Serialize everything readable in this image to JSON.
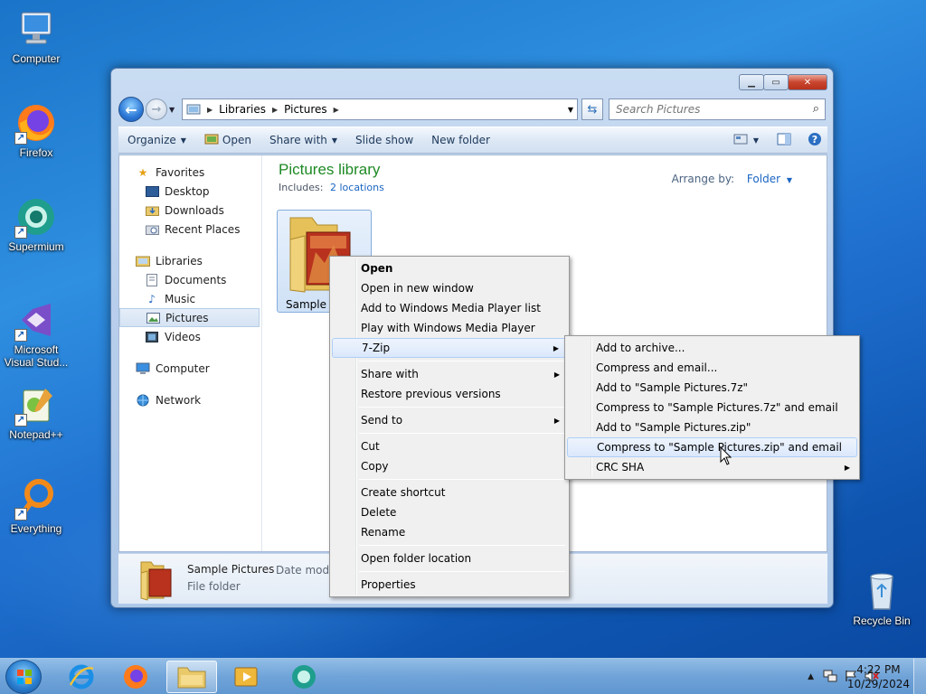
{
  "desktop": {
    "icons": [
      {
        "label": "Computer",
        "icon": "computer-icon"
      },
      {
        "label": "Firefox",
        "icon": "firefox-icon"
      },
      {
        "label": "Supermium",
        "icon": "supermium-icon"
      },
      {
        "label": "Microsoft Visual Stud...",
        "icon": "visual-studio-icon"
      },
      {
        "label": "Notepad++",
        "icon": "notepadpp-icon"
      },
      {
        "label": "Everything",
        "icon": "everything-icon"
      },
      {
        "label": "Recycle Bin",
        "icon": "recycle-bin-icon"
      }
    ]
  },
  "explorer": {
    "breadcrumb": [
      "Libraries",
      "Pictures"
    ],
    "search_placeholder": "Search Pictures",
    "toolbar": {
      "organize": "Organize",
      "open": "Open",
      "share_with": "Share with",
      "slide_show": "Slide show",
      "new_folder": "New folder"
    },
    "nav": {
      "favorites": "Favorites",
      "desktop": "Desktop",
      "downloads": "Downloads",
      "recent_places": "Recent Places",
      "libraries": "Libraries",
      "documents": "Documents",
      "music": "Music",
      "pictures": "Pictures",
      "videos": "Videos",
      "computer": "Computer",
      "network": "Network"
    },
    "library_title": "Pictures library",
    "includes_label": "Includes:",
    "includes_link": "2 locations",
    "arrange_label": "Arrange by:",
    "arrange_value": "Folder",
    "folder_label": "Sample P",
    "details": {
      "name": "Sample Pictures",
      "type": "File folder",
      "modified_label": "Date modif"
    }
  },
  "context_menu": {
    "open": "Open",
    "open_new_window": "Open in new window",
    "add_wmp_list": "Add to Windows Media Player list",
    "play_wmp": "Play with Windows Media Player",
    "seven_zip": "7-Zip",
    "share_with": "Share with",
    "restore": "Restore previous versions",
    "send_to": "Send to",
    "cut": "Cut",
    "copy": "Copy",
    "create_shortcut": "Create shortcut",
    "delete": "Delete",
    "rename": "Rename",
    "open_folder_location": "Open folder location",
    "properties": "Properties"
  },
  "zip_submenu": {
    "add_archive": "Add to archive...",
    "compress_email": "Compress and email...",
    "add_7z": "Add to \"Sample Pictures.7z\"",
    "compress_7z_email": "Compress to \"Sample Pictures.7z\" and email",
    "add_zip": "Add to \"Sample Pictures.zip\"",
    "compress_zip_email": "Compress to \"Sample Pictures.zip\" and email",
    "crc_sha": "CRC SHA"
  },
  "taskbar": {
    "time": "4:22 PM",
    "date": "10/29/2024"
  },
  "colors": {
    "library_title": "#1e8a24",
    "link": "#1a65c3",
    "menu_highlight": "#dbe8fb"
  }
}
